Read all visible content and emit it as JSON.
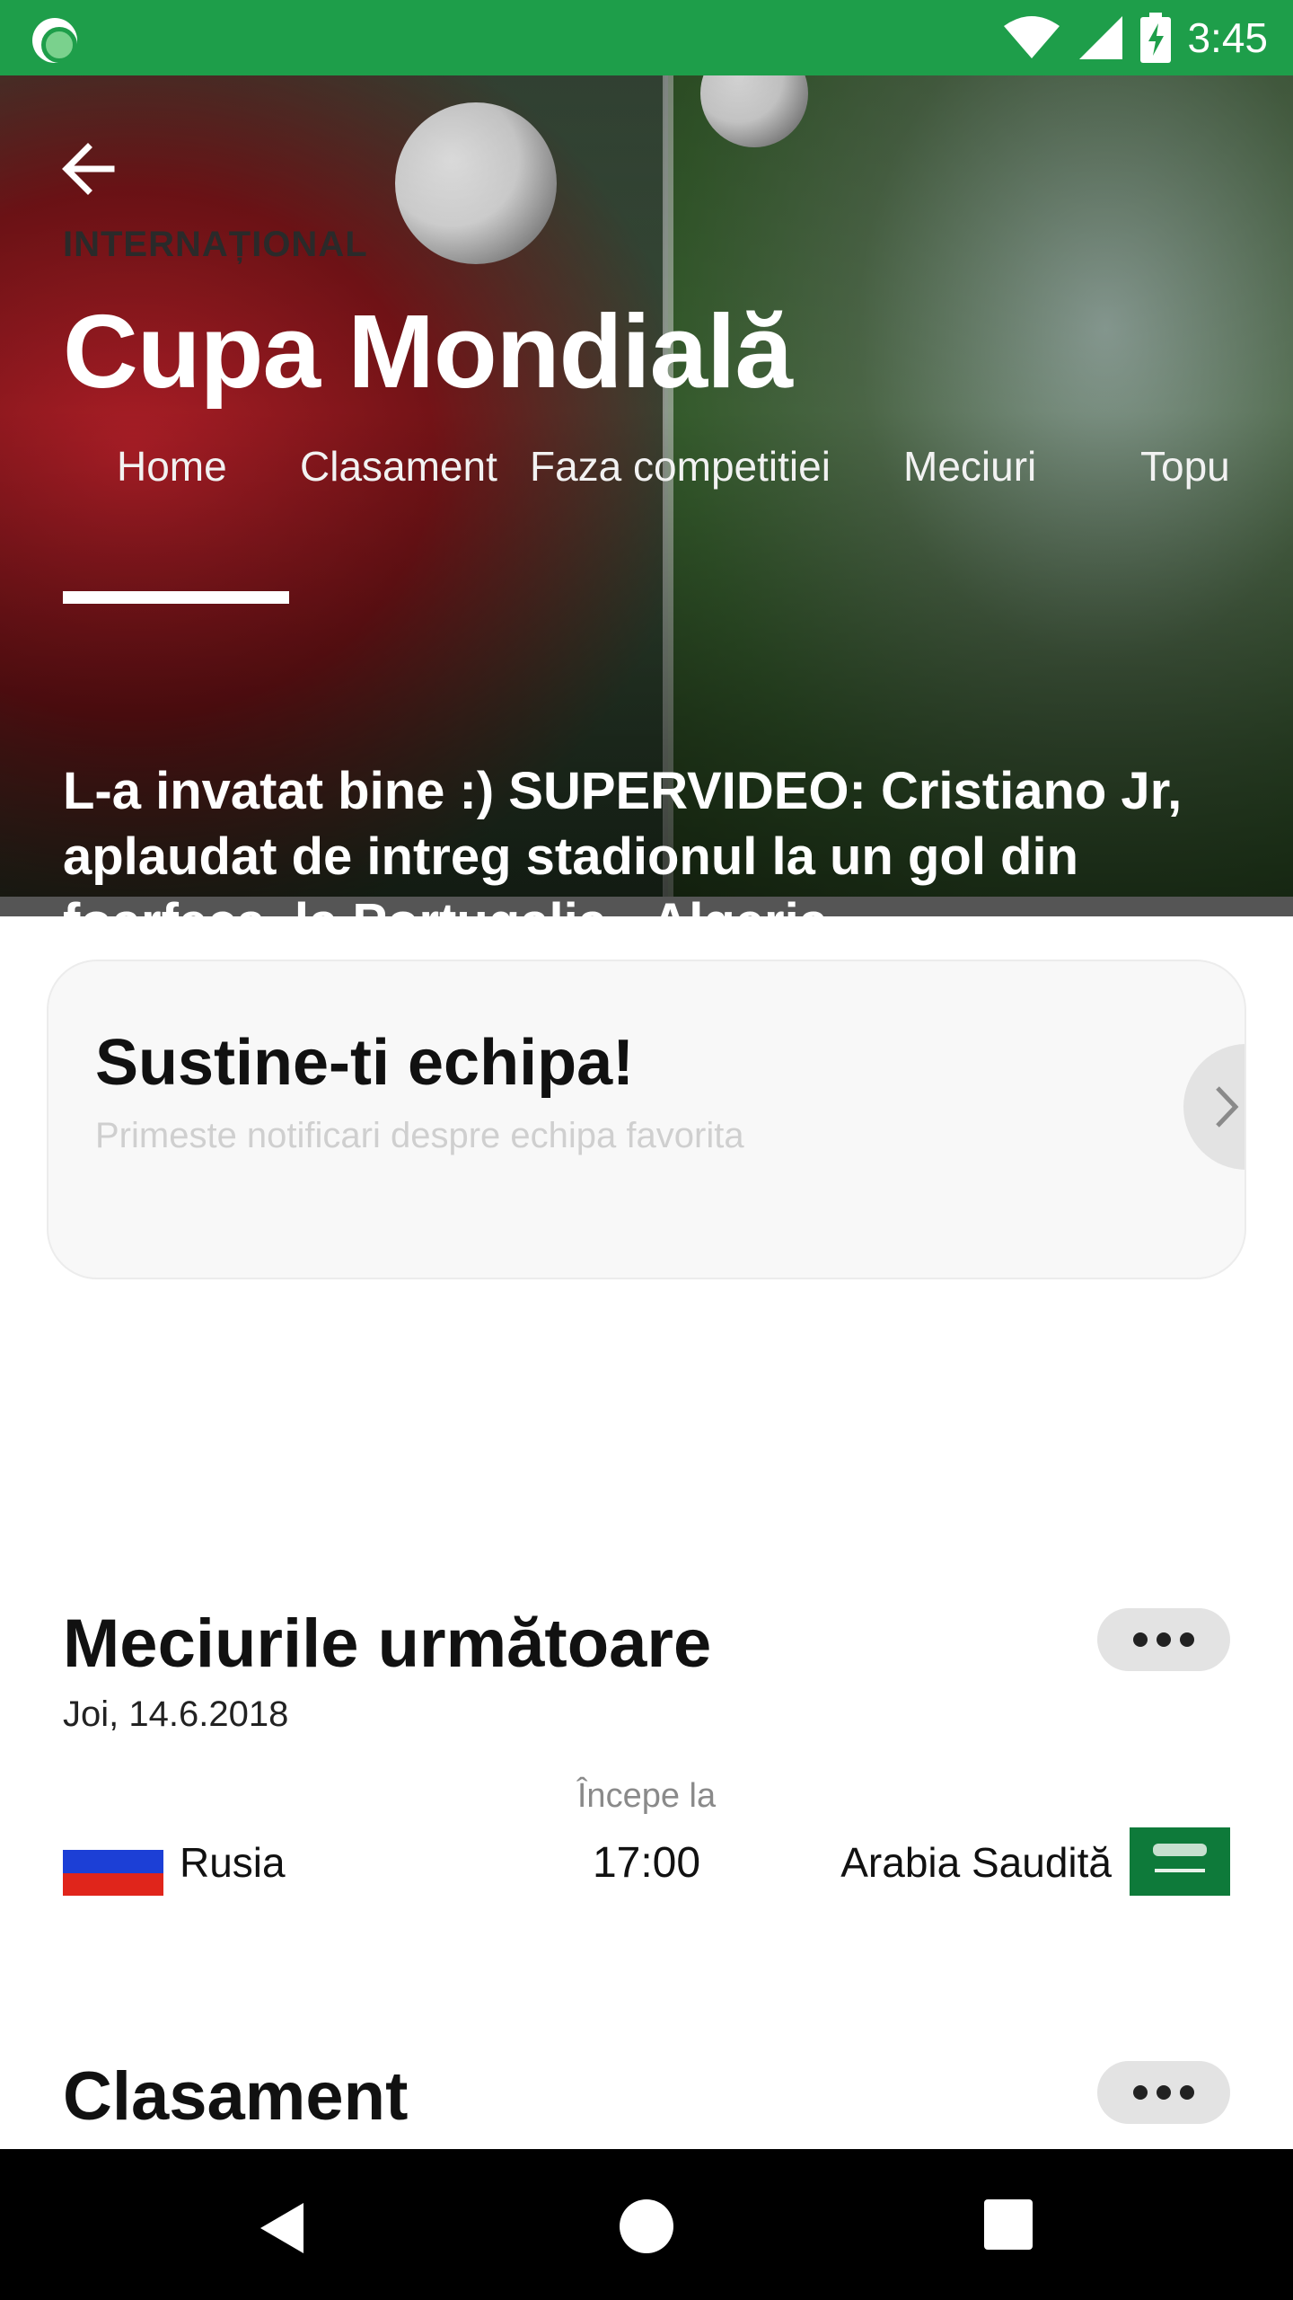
{
  "status_bar": {
    "time": "3:45",
    "icons": [
      "notification-app-icon",
      "wifi-icon",
      "signal-icon",
      "battery-charging-icon"
    ],
    "background": "#1e9e4a"
  },
  "hero": {
    "section_label": "INTERNAȚIONAL",
    "title": "Cupa Mondială",
    "tabs": [
      {
        "label": "Home",
        "active": true
      },
      {
        "label": "Clasament",
        "active": false
      },
      {
        "label": "Faza competitiei",
        "active": false
      },
      {
        "label": "Meciuri",
        "active": false
      },
      {
        "label": "Topu",
        "active": false
      }
    ],
    "headline": "L-a invatat bine :) SUPERVIDEO: Cristiano Jr, aplaudat de intreg stadionul la un gol din foarfeca, la Portugalia - Algeria"
  },
  "team_card": {
    "title": "Sustine-ti echipa!",
    "subtitle": "Primeste notificari despre echipa favorita"
  },
  "upcoming": {
    "title": "Meciurile următoare",
    "date": "Joi, 14.6.2018",
    "starts_label": "Începe la",
    "match": {
      "home_team": "Rusia",
      "time": "17:00",
      "away_team": "Arabia Saudită"
    }
  },
  "standings": {
    "title": "Clasament"
  },
  "colors": {
    "accent_green": "#1e9e4a",
    "card_bg": "#f8f8f8",
    "pill_bg": "#e3e3e3"
  }
}
